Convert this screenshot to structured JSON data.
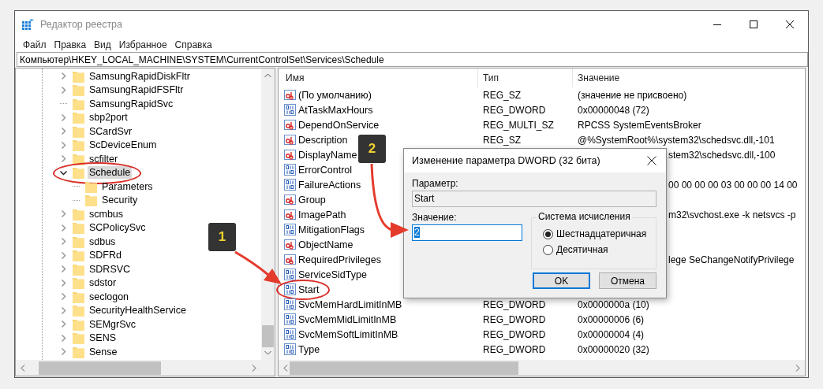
{
  "window": {
    "title": "Редактор реестра"
  },
  "menu": [
    "Файл",
    "Правка",
    "Вид",
    "Избранное",
    "Справка"
  ],
  "address": "Компьютер\\HKEY_LOCAL_MACHINE\\SYSTEM\\CurrentControlSet\\Services\\Schedule",
  "tree": {
    "items": [
      {
        "label": "SamsungRapidDiskFltr",
        "kind": "node",
        "expanded": false,
        "selected": false,
        "circled": false
      },
      {
        "label": "SamsungRapidFSFltr",
        "kind": "node",
        "expanded": false,
        "selected": false,
        "circled": false
      },
      {
        "label": "SamsungRapidSvc",
        "kind": "leaf",
        "selected": false,
        "circled": false
      },
      {
        "label": "sbp2port",
        "kind": "node",
        "expanded": false,
        "selected": false,
        "circled": false
      },
      {
        "label": "SCardSvr",
        "kind": "node",
        "expanded": false,
        "selected": false,
        "circled": false
      },
      {
        "label": "ScDeviceEnum",
        "kind": "node",
        "expanded": false,
        "selected": false,
        "circled": false
      },
      {
        "label": "scfilter",
        "kind": "node",
        "expanded": false,
        "selected": false,
        "circled": false
      },
      {
        "label": "Schedule",
        "kind": "node",
        "expanded": true,
        "selected": true,
        "circled": true,
        "children": [
          {
            "label": "Parameters",
            "kind": "leaf",
            "selected": false,
            "circled": false
          },
          {
            "label": "Security",
            "kind": "leaf",
            "selected": false,
            "circled": false
          }
        ]
      },
      {
        "label": "scmbus",
        "kind": "node",
        "expanded": false,
        "selected": false,
        "circled": false
      },
      {
        "label": "SCPolicySvc",
        "kind": "node",
        "expanded": false,
        "selected": false,
        "circled": false
      },
      {
        "label": "sdbus",
        "kind": "node",
        "expanded": false,
        "selected": false,
        "circled": false
      },
      {
        "label": "SDFRd",
        "kind": "node",
        "expanded": false,
        "selected": false,
        "circled": false
      },
      {
        "label": "SDRSVC",
        "kind": "node",
        "expanded": false,
        "selected": false,
        "circled": false
      },
      {
        "label": "sdstor",
        "kind": "node",
        "expanded": false,
        "selected": false,
        "circled": false
      },
      {
        "label": "seclogon",
        "kind": "node",
        "expanded": false,
        "selected": false,
        "circled": false
      },
      {
        "label": "SecurityHealthService",
        "kind": "node",
        "expanded": false,
        "selected": false,
        "circled": false
      },
      {
        "label": "SEMgrSvc",
        "kind": "node",
        "expanded": false,
        "selected": false,
        "circled": false
      },
      {
        "label": "SENS",
        "kind": "node",
        "expanded": false,
        "selected": false,
        "circled": false
      },
      {
        "label": "Sense",
        "kind": "node",
        "expanded": false,
        "selected": false,
        "circled": false
      }
    ]
  },
  "list": {
    "columns": [
      "Имя",
      "Тип",
      "Значение"
    ],
    "rows": [
      {
        "name": "(По умолчанию)",
        "kind": "sz",
        "type": "REG_SZ",
        "value": "(значение не присвоено)",
        "covered": false,
        "circled": false
      },
      {
        "name": "AtTaskMaxHours",
        "kind": "dword",
        "type": "REG_DWORD",
        "value": "0x00000048 (72)",
        "covered": false,
        "circled": false
      },
      {
        "name": "DependOnService",
        "kind": "sz",
        "type": "REG_MULTI_SZ",
        "value": "RPCSS SystemEventsBroker",
        "covered": false,
        "circled": false
      },
      {
        "name": "Description",
        "kind": "sz",
        "type": "REG_SZ",
        "value": "@%SystemRoot%\\system32\\schedsvc.dll,-101",
        "covered": false,
        "circled": false
      },
      {
        "name": "DisplayName",
        "kind": "sz",
        "value": "stem32\\schedsvc.dll,-100",
        "covered": true,
        "circled": false
      },
      {
        "name": "ErrorControl",
        "kind": "dword",
        "covered": true,
        "circled": false
      },
      {
        "name": "FailureActions",
        "kind": "dword",
        "value": "00 00 00 00 03 00 00 00 14 00",
        "covered": true,
        "circled": false
      },
      {
        "name": "Group",
        "kind": "sz",
        "covered": true,
        "circled": false
      },
      {
        "name": "ImagePath",
        "kind": "sz",
        "value": "m32\\svchost.exe -k netsvcs -p",
        "covered": true,
        "circled": false
      },
      {
        "name": "MitigationFlags",
        "kind": "dword",
        "covered": true,
        "circled": false
      },
      {
        "name": "ObjectName",
        "kind": "sz",
        "covered": true,
        "circled": false
      },
      {
        "name": "RequiredPrivileges",
        "kind": "sz",
        "value": "lege SeChangeNotifyPrivilege",
        "covered": true,
        "circled": false
      },
      {
        "name": "ServiceSidType",
        "kind": "dword",
        "covered": true,
        "circled": false
      },
      {
        "name": "Start",
        "kind": "dword",
        "covered": true,
        "circled": true
      },
      {
        "name": "SvcMemHardLimitInMB",
        "kind": "dword",
        "type": "REG_DWORD",
        "value": "0x0000000a (10)",
        "covered": false,
        "circled": false
      },
      {
        "name": "SvcMemMidLimitInMB",
        "kind": "dword",
        "type": "REG_DWORD",
        "value": "0x00000006 (6)",
        "covered": false,
        "circled": false
      },
      {
        "name": "SvcMemSoftLimitInMB",
        "kind": "dword",
        "type": "REG_DWORD",
        "value": "0x00000004 (4)",
        "covered": false,
        "circled": false
      },
      {
        "name": "Type",
        "kind": "dword",
        "type": "REG_DWORD",
        "value": "0x00000020 (32)",
        "covered": false,
        "circled": false
      }
    ]
  },
  "dialog": {
    "title": "Изменение параметра DWORD (32 бита)",
    "name_label": "Параметр:",
    "name_value": "Start",
    "value_label": "Значение:",
    "value": "2",
    "value_highlighted": true,
    "group_label": "Система исчисления",
    "radios": [
      {
        "label": "Шестнадцатеричная",
        "selected": true
      },
      {
        "label": "Десятичная",
        "selected": false
      }
    ],
    "buttons": [
      {
        "label": "OK",
        "default": true
      },
      {
        "label": "Отмена",
        "default": false
      }
    ]
  },
  "badges": [
    {
      "label": "1"
    },
    {
      "label": "2"
    }
  ]
}
